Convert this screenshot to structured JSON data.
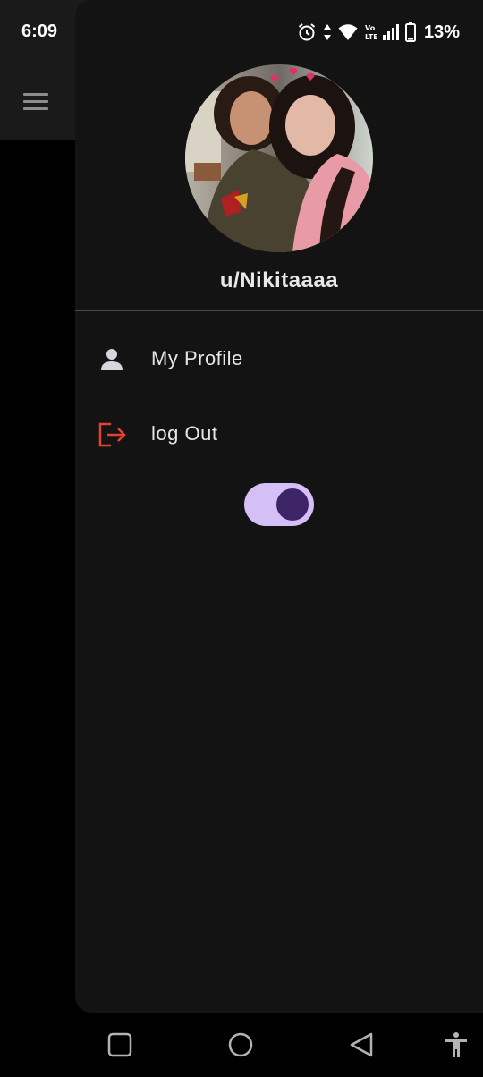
{
  "status_bar": {
    "time": "6:09",
    "battery": "13%",
    "icons": [
      "alarm-icon",
      "data-arrows-icon",
      "wifi-icon",
      "volte-icon",
      "signal-icon",
      "battery-icon"
    ]
  },
  "background_app": {
    "menu_icon": "hamburger-menu-icon"
  },
  "drawer": {
    "avatar": "profile-photo",
    "username": "u/Nikitaaaa",
    "items": [
      {
        "label": "My Profile",
        "icon": "person-icon"
      },
      {
        "label": "log Out",
        "icon": "logout-icon"
      }
    ],
    "theme_toggle": {
      "state": "on"
    }
  },
  "nav_bar": {
    "buttons": [
      "recents-square-icon",
      "home-circle-icon",
      "back-triangle-icon",
      "accessibility-icon"
    ]
  },
  "colors": {
    "drawer_bg": "#131314",
    "logout_accent": "#e0432f",
    "toggle_track": "#d4bff7",
    "toggle_knob": "#3c2466"
  }
}
